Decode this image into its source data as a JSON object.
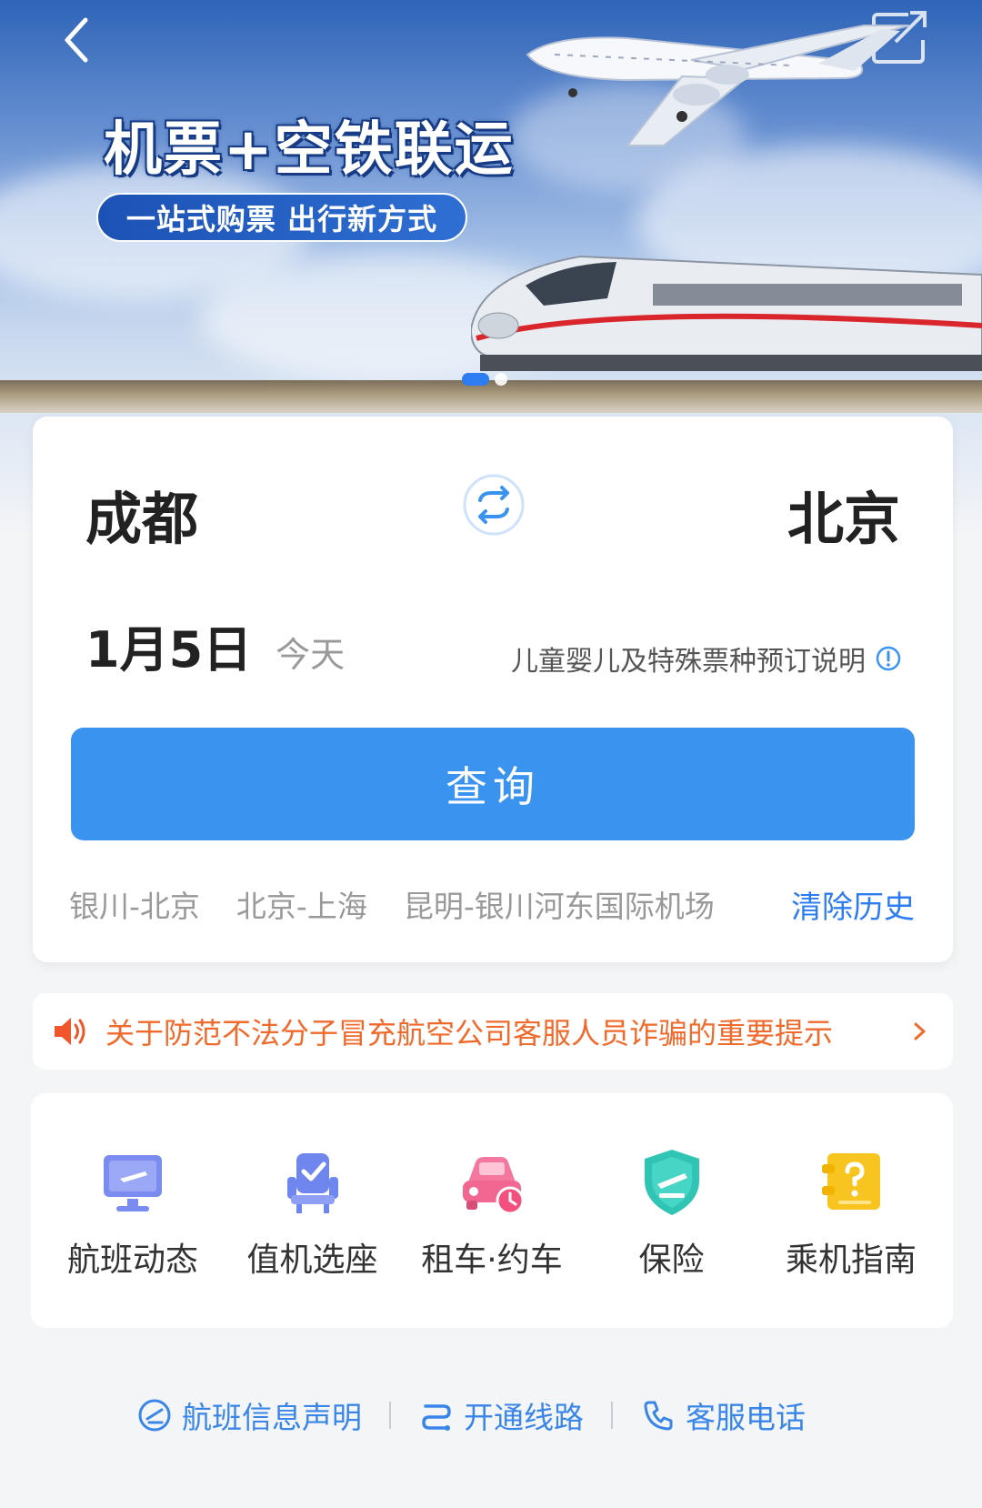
{
  "banner": {
    "headline": "机票+空铁联运",
    "tagline": "一站式购票 出行新方式",
    "carousel": {
      "count": 2,
      "active_index": 0
    }
  },
  "search": {
    "from_city": "成都",
    "to_city": "北京",
    "date": "1月5日",
    "date_hint": "今天",
    "special_ticket_note": "儿童婴儿及特殊票种预订说明",
    "query_button": "查询",
    "history": [
      "银川-北京",
      "北京-上海",
      "昆明-银川河东国际机场"
    ],
    "clear_history": "清除历史"
  },
  "notice": {
    "text": "关于防范不法分子冒充航空公司客服人员诈骗的重要提示"
  },
  "services": [
    {
      "label": "航班动态",
      "icon": "flight-status-icon"
    },
    {
      "label": "值机选座",
      "icon": "seat-selection-icon"
    },
    {
      "label": "租车·约车",
      "icon": "car-rental-icon"
    },
    {
      "label": "保险",
      "icon": "insurance-shield-icon"
    },
    {
      "label": "乘机指南",
      "icon": "boarding-guide-icon"
    }
  ],
  "footer": {
    "links": [
      "航班信息声明",
      "开通线路",
      "客服电话"
    ]
  },
  "colors": {
    "primary_blue": "#3b93f0",
    "link_blue": "#2e7cf2",
    "notice_orange": "#f06a2c"
  }
}
